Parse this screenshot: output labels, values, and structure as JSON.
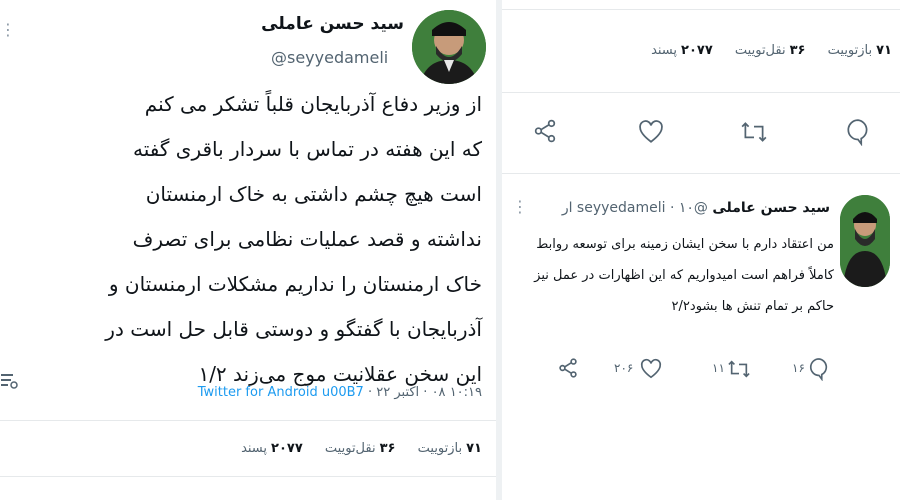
{
  "left_tweet": {
    "author_name": "سید حسن عاملی",
    "handle": "@seyyedameli",
    "body_lines": [
      "از وزیر دفاع آذربایجان قلباً تشکر می کنم",
      "که این هفته در تماس با سردار باقری گفته",
      "است هیچ چشم داشتی به خاک ارمنستان",
      "نداشته و قصد عملیات نظامی برای تصرف",
      "خاک ارمنستان را نداریم مشکلات ارمنستان و",
      "آذربایجان با گفتگو و دوستی قابل حل است در",
      "این سخن عقلانیت موج می‌زند ۱/۲"
    ],
    "time_date": "۱۰:۱۹ ۰۸ · اکتبر ۲۲",
    "source": "Twitter for Android",
    "source_suffix": "u00B7",
    "stats": {
      "retweets_count": "۷۱",
      "retweets_label": "بازتوییت",
      "quotes_count": "۳۶",
      "quotes_label": "نقل‌توییت",
      "likes_count": "۲۰۷۷",
      "likes_label": "پسند"
    }
  },
  "right_stats": {
    "retweets_count": "۷۱",
    "retweets_label": "بازتوییت",
    "quotes_count": "۳۶",
    "quotes_label": "نقل‌توییت",
    "likes_count": "۲۰۷۷",
    "likes_label": "پسند"
  },
  "right_tweet": {
    "author_name": "سید حسن عاملی",
    "handle": "@seyyedameli",
    "time": "۱۰ ار",
    "body_lines": [
      "من اعتقاد دارم با سخن ایشان زمینه برای توسعه روابط",
      "کاملاً فراهم است امیدواریم که این اظهارات در عمل نیز",
      "حاکم بر تمام تنش ها بشود۲/۲"
    ],
    "reply_count": "۱۶",
    "retweet_count": "۱۱",
    "like_count": "۲۰۶"
  },
  "colors": {
    "accent": "#1d9bf0",
    "text": "#0f1419",
    "muted": "#536471",
    "divider": "#e6e9eb"
  }
}
